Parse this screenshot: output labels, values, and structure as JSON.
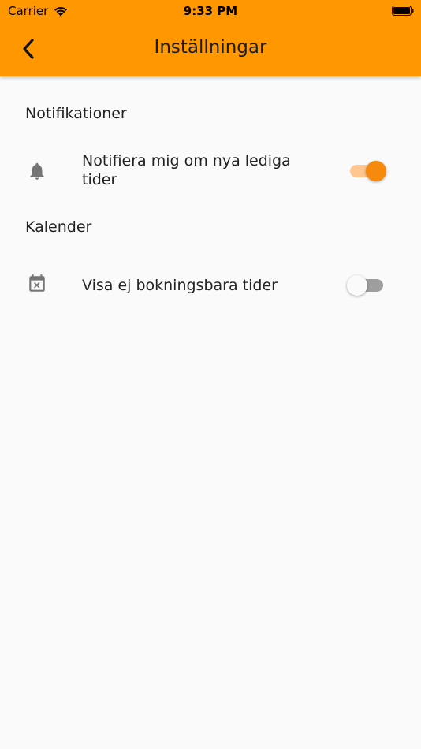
{
  "status_bar": {
    "carrier": "Carrier",
    "time": "9:33 PM",
    "wifi_icon": "wifi-icon",
    "battery_icon": "battery-icon"
  },
  "app_bar": {
    "title": "Inställningar",
    "back_icon": "chevron-left-icon",
    "background_color": "#ff9800"
  },
  "sections": [
    {
      "header": "Notifikationer",
      "rows": [
        {
          "icon": "bell-icon",
          "label": "Notifiera mig om nya lediga tider",
          "toggle_on": true
        }
      ]
    },
    {
      "header": "Kalender",
      "rows": [
        {
          "icon": "calendar-x-icon",
          "label": "Visa ej bokningsbara tider",
          "toggle_on": false
        }
      ]
    }
  ],
  "colors": {
    "accent": "#f58a0c",
    "accent_track": "#ffc78f",
    "off_track": "#9e9e9e",
    "background": "#fafafa"
  }
}
